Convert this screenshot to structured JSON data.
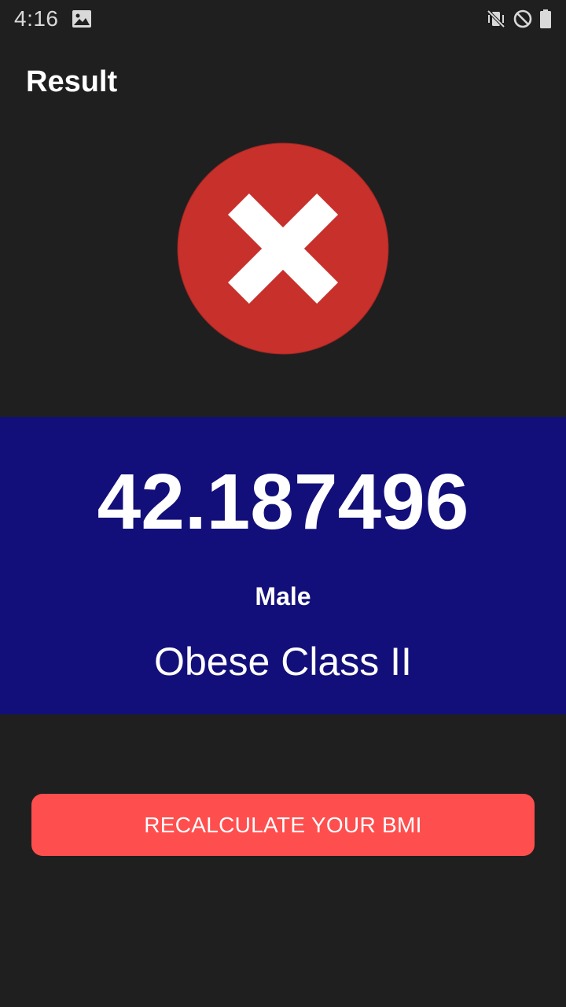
{
  "status_bar": {
    "time": "4:16",
    "left_icons": [
      "image-icon"
    ],
    "right_icons": [
      "vibrate-mute-icon",
      "do-not-disturb-icon",
      "battery-icon"
    ]
  },
  "header": {
    "title": "Result"
  },
  "result": {
    "status_icon": "error-x-icon",
    "bmi_value": "42.187496",
    "gender": "Male",
    "category": "Obese Class II"
  },
  "actions": {
    "recalculate_label": "RECALCULATE YOUR BMI"
  },
  "colors": {
    "background": "#1f1f1f",
    "panel": "#120f7a",
    "error_red": "#c8302c",
    "button": "#ff4e4e",
    "text": "#ffffff"
  }
}
